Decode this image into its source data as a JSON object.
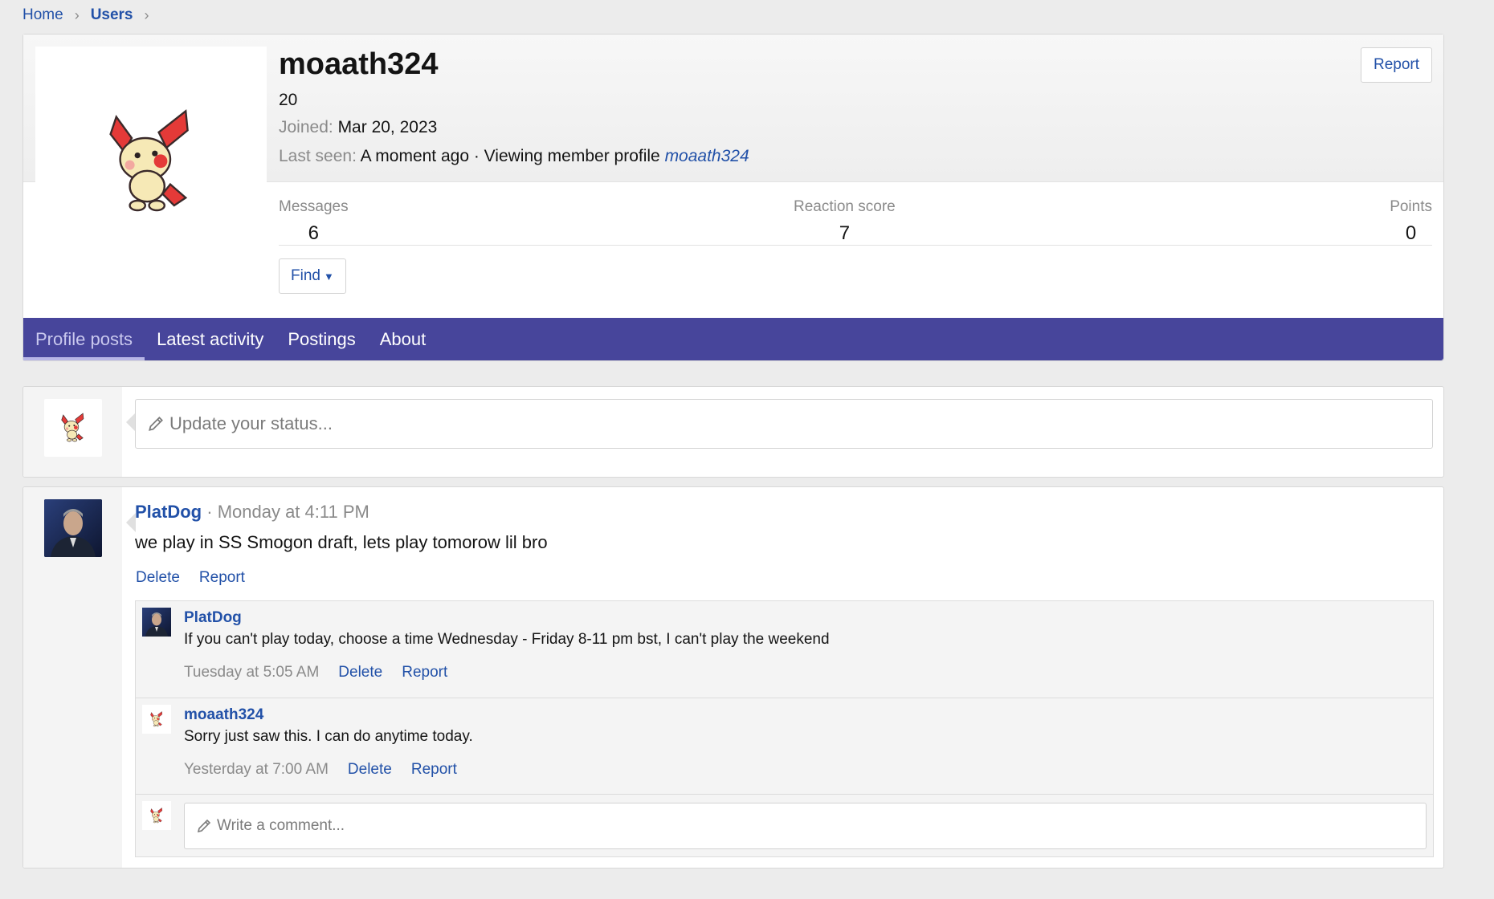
{
  "breadcrumb": {
    "home": "Home",
    "users": "Users"
  },
  "profile": {
    "username": "moaath324",
    "title": "20",
    "joined_label": "Joined:",
    "joined_value": "Mar 20, 2023",
    "lastseen_label": "Last seen:",
    "lastseen_value": "A moment ago · Viewing member profile",
    "lastseen_link": "moaath324",
    "report_label": "Report",
    "avatar_icon": "plusle-sprite-avatar",
    "stats": {
      "messages_label": "Messages",
      "messages_value": "6",
      "reaction_label": "Reaction score",
      "reaction_value": "7",
      "points_label": "Points",
      "points_value": "0"
    },
    "find_label": "Find"
  },
  "tabs": [
    {
      "label": "Profile posts",
      "active": true
    },
    {
      "label": "Latest activity"
    },
    {
      "label": "Postings"
    },
    {
      "label": "About"
    }
  ],
  "status": {
    "placeholder": "Update your status..."
  },
  "post": {
    "author": "PlatDog",
    "time": "· Monday at 4:11 PM",
    "body": "we play in SS Smogon draft, lets play tomorow lil bro",
    "delete_label": "Delete",
    "report_label": "Report",
    "comments": [
      {
        "author": "PlatDog",
        "body": "If you can't play today, choose a time Wednesday - Friday 8-11 pm bst, I can't play the weekend",
        "time": "Tuesday at 5:05 AM",
        "delete_label": "Delete",
        "report_label": "Report"
      },
      {
        "author": "moaath324",
        "body": "Sorry just saw this. I can do anytime today.",
        "time": "Yesterday at 7:00 AM",
        "delete_label": "Delete",
        "report_label": "Report"
      }
    ],
    "comment_placeholder": "Write a comment..."
  },
  "colors": {
    "accent": "#47459b",
    "link": "#2251a8"
  }
}
